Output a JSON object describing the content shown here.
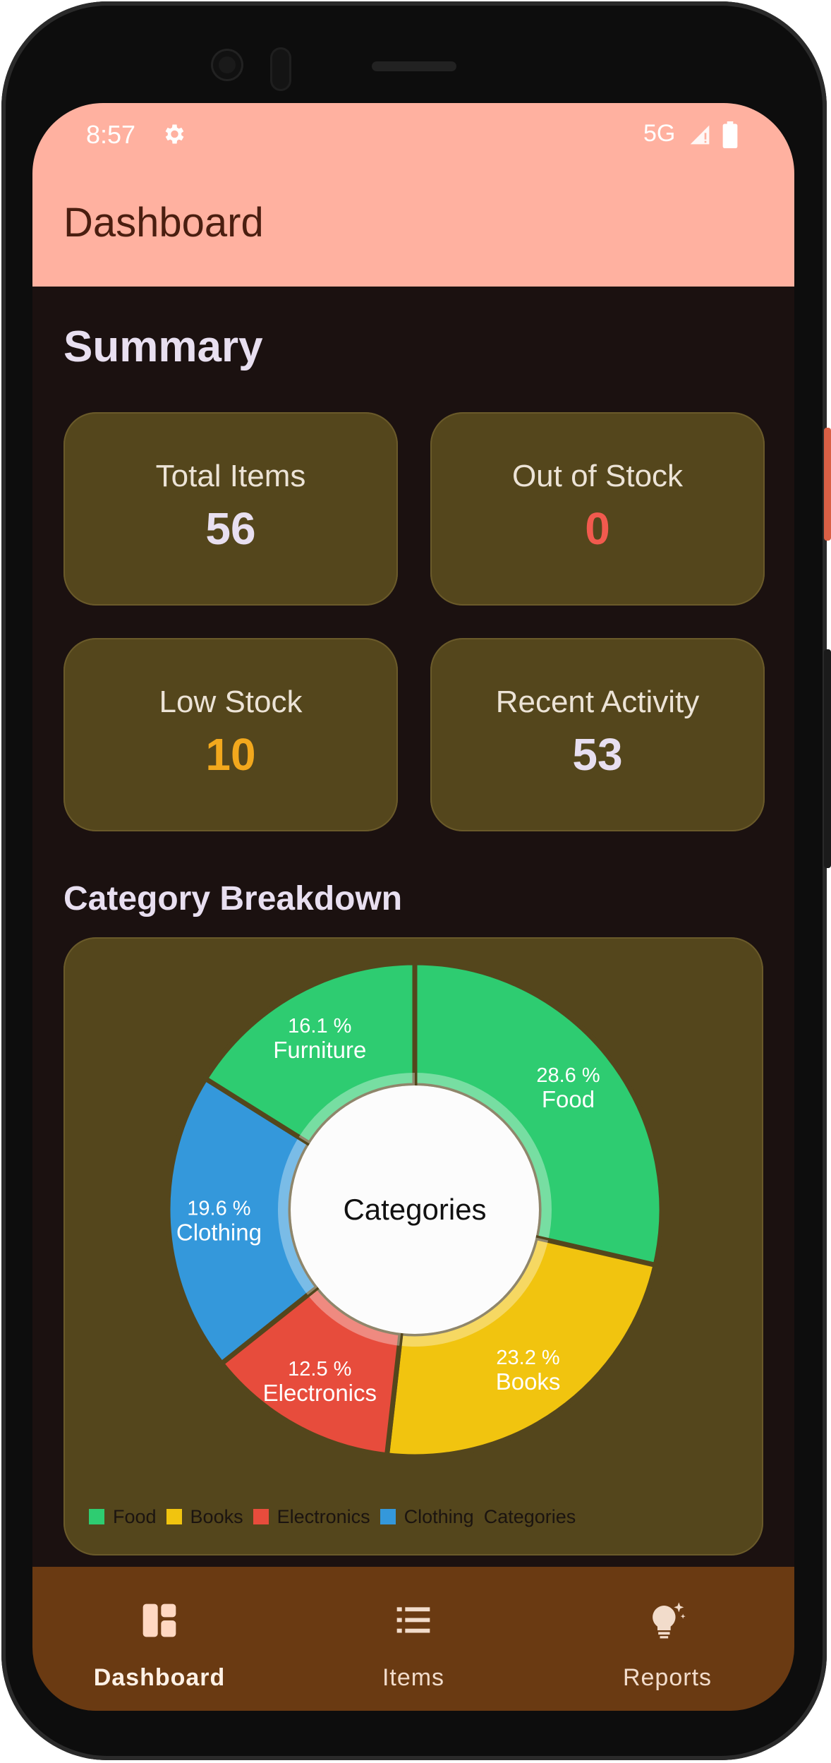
{
  "status_bar": {
    "time": "8:57",
    "network": "5G"
  },
  "app_bar": {
    "title": "Dashboard"
  },
  "summary": {
    "title": "Summary",
    "cards": [
      {
        "label": "Total Items",
        "value": "56",
        "color": "#e8dff0"
      },
      {
        "label": "Out of Stock",
        "value": "0",
        "color": "#f25a4e"
      },
      {
        "label": "Low Stock",
        "value": "10",
        "color": "#f2a81d"
      },
      {
        "label": "Recent Activity",
        "value": "53",
        "color": "#e8dff0"
      }
    ]
  },
  "category_breakdown": {
    "title": "Category Breakdown",
    "center_label": "Categories"
  },
  "chart_data": {
    "type": "pie",
    "title": "Category Breakdown",
    "center_label": "Categories",
    "categories": [
      "Food",
      "Books",
      "Electronics",
      "Clothing",
      "Furniture"
    ],
    "values": [
      28.6,
      23.2,
      12.5,
      19.6,
      16.1
    ],
    "value_labels": [
      "28.6 %",
      "23.2 %",
      "12.5 %",
      "19.6 %",
      "16.1 %"
    ],
    "colors": [
      "#2ecc71",
      "#f1c40f",
      "#e74c3c",
      "#3498db",
      "#2ecc71"
    ],
    "legend": [
      "Food",
      "Books",
      "Electronics",
      "Clothing",
      "Categories"
    ],
    "legend_colors": [
      "#2ecc71",
      "#f1c40f",
      "#e74c3c",
      "#3498db"
    ]
  },
  "bottom_nav": {
    "items": [
      {
        "label": "Dashboard",
        "icon": "dashboard-icon",
        "active": true
      },
      {
        "label": "Items",
        "icon": "list-icon",
        "active": false
      },
      {
        "label": "Reports",
        "icon": "lightbulb-icon",
        "active": false
      }
    ]
  }
}
